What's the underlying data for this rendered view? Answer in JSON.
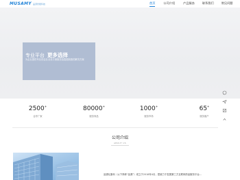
{
  "header": {
    "logo_mark": "MUSAMY",
    "logo_sub": "品源智能科技",
    "nav": [
      {
        "label": "首页",
        "active": true
      },
      {
        "label": "公司介绍",
        "active": false
      },
      {
        "label": "产品服务",
        "active": false
      },
      {
        "label": "联系我们",
        "active": false
      },
      {
        "label": "常见问题",
        "active": false
      }
    ]
  },
  "hero": {
    "title_a": "专业平台",
    "title_b": "更多选择",
    "description": "为企业提供专业的企业业务方案服务及智能制造的解决方案"
  },
  "stats": [
    {
      "value": "2500",
      "suffix": "+",
      "label": "合作厂家"
    },
    {
      "value": "80000",
      "suffix": "+",
      "label": "服务商品"
    },
    {
      "value": "1000",
      "suffix": "+",
      "label": "服务市场"
    },
    {
      "value": "65",
      "suffix": "+",
      "label": "服务客户"
    }
  ],
  "about": {
    "title": "公司介绍",
    "subtitle": "ABOUT US",
    "text": "品源仕集科（以下简称“品源”）成立于2018年4月，是致力于发展第三方互联网药品服务平台…"
  },
  "side_tools": [
    "chat-icon",
    "send-icon",
    "edit-icon",
    "top-icon"
  ],
  "colors": {
    "accent": "#1b7fd6",
    "hero_card": "#aab9d0"
  }
}
